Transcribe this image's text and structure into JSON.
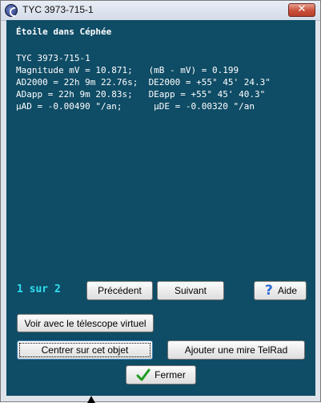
{
  "window": {
    "title": "TYC 3973-715-1",
    "close_label": "✕"
  },
  "info": {
    "heading": "Étoile dans Céphée",
    "name": "TYC 3973-715-1",
    "line_magnitude": "Magnitude mV = 10.871;   (mB - mV) = 0.199",
    "line_j2000": "AD2000 = 22h 9m 22.76s;  DE2000 = +55° 45' 24.3\"",
    "line_app": "ADapp = 22h 9m 20.83s;   DEapp = +55° 45' 40.3\"",
    "line_proper_motion": "µAD = -0.00490 \"/an;      µDE = -0.00320 \"/an"
  },
  "pager": {
    "text": "1 sur 2"
  },
  "buttons": {
    "previous": "Précédent",
    "next": "Suivant",
    "help": "Aide",
    "virtual_telescope": "Voir avec le télescope virtuel",
    "center": "Centrer sur cet objet",
    "telrad": "Ajouter une mire TelRad",
    "close": "Fermer"
  },
  "icons": {
    "help": "question-mark-icon",
    "close": "green-checkmark-icon",
    "app": "app-logo-icon"
  }
}
